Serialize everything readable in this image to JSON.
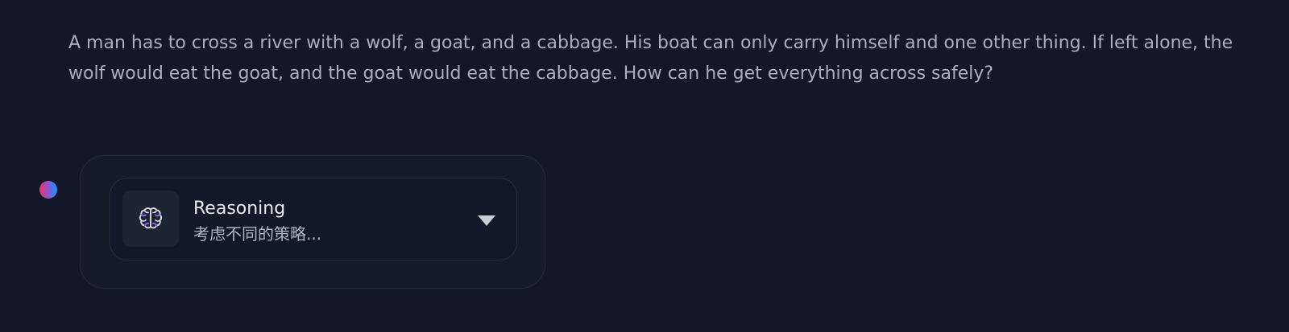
{
  "user_message": {
    "text": "A man has to cross a river with a wolf, a goat, and a cabbage. His boat can only carry himself and one other thing. If left alone, the wolf would eat the goat, and the goat would eat the cabbage. How can he get everything across safely?"
  },
  "assistant": {
    "avatar_icon": "gradient-dot",
    "reasoning": {
      "title": "Reasoning",
      "status": "考虑不同的策略...",
      "icon": "brain-icon",
      "expand_icon": "chevron-down-icon",
      "expanded": false
    }
  },
  "colors": {
    "background": "#121827",
    "text": "#a9b0bc",
    "brain_accent": "#8b5cf6",
    "avatar_gradient": [
      "#e23a6a",
      "#3a86f5"
    ]
  }
}
